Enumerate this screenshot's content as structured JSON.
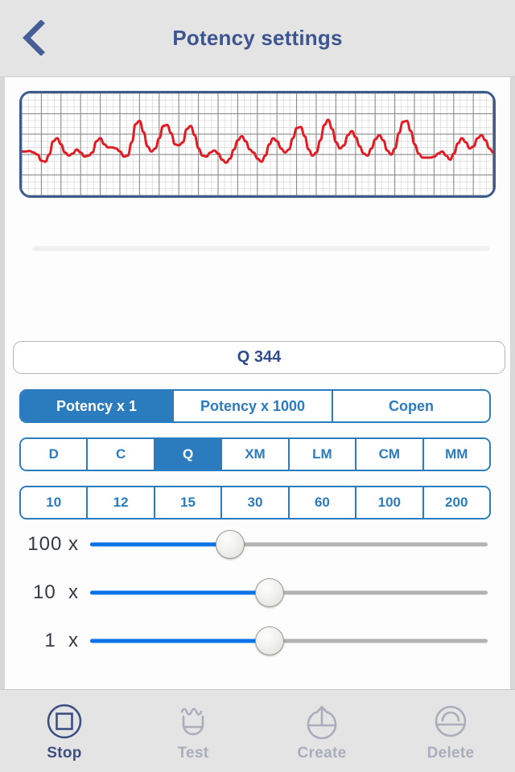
{
  "header": {
    "title": "Potency settings",
    "back_icon": "chevron-left-icon",
    "accent": "#3d5691"
  },
  "chart_data": {
    "type": "line",
    "title": "",
    "xlabel": "",
    "ylabel": "",
    "grid": true,
    "legend": null,
    "line_color": "#e31b23",
    "border_color": "#3d5b8c",
    "grid_color": "#8a8a8a",
    "minor_grid_color": "#d0d0d0",
    "ylim": [
      0,
      10
    ],
    "xlim": [
      0,
      120
    ],
    "x": [
      0,
      1,
      2,
      3,
      4,
      5,
      6,
      7,
      8,
      9,
      10,
      11,
      12,
      13,
      14,
      15,
      16,
      17,
      18,
      19,
      20,
      21,
      22,
      23,
      24,
      25,
      26,
      27,
      28,
      29,
      30,
      31,
      32,
      33,
      34,
      35,
      36,
      37,
      38,
      39,
      40,
      41,
      42,
      43,
      44,
      45,
      46,
      47,
      48,
      49,
      50,
      51,
      52,
      53,
      54,
      55,
      56,
      57,
      58,
      59,
      60,
      61,
      62,
      63,
      64,
      65,
      66,
      67,
      68,
      69,
      70,
      71,
      72,
      73,
      74,
      75,
      76,
      77,
      78,
      79,
      80,
      81,
      82,
      83,
      84,
      85,
      86,
      87,
      88,
      89,
      90,
      91,
      92,
      93,
      94,
      95,
      96,
      97,
      98,
      99,
      100,
      101,
      102,
      103,
      104,
      105,
      106,
      107,
      108,
      109,
      110,
      111,
      112,
      113,
      114,
      115,
      116,
      117,
      118,
      119,
      120
    ],
    "values": [
      4.3,
      4.3,
      4.35,
      4.2,
      4.0,
      3.4,
      3.3,
      4.0,
      5.3,
      5.6,
      5.0,
      4.2,
      3.9,
      4.1,
      4.5,
      4.2,
      3.8,
      3.9,
      4.2,
      5.3,
      5.6,
      5.0,
      4.7,
      4.7,
      4.6,
      4.3,
      3.8,
      3.9,
      5.2,
      7.0,
      7.3,
      6.2,
      4.8,
      4.3,
      4.6,
      5.6,
      6.8,
      6.9,
      6.1,
      5.0,
      4.9,
      5.2,
      6.5,
      6.8,
      5.9,
      4.6,
      3.9,
      3.8,
      4.2,
      4.4,
      4.1,
      3.5,
      3.2,
      3.6,
      4.5,
      5.4,
      5.8,
      5.3,
      4.5,
      4.2,
      3.6,
      3.3,
      3.9,
      5.0,
      5.6,
      5.3,
      4.6,
      4.2,
      4.5,
      5.6,
      6.6,
      6.7,
      5.8,
      4.5,
      3.9,
      4.2,
      5.4,
      6.9,
      7.4,
      6.5,
      5.2,
      4.6,
      4.9,
      5.9,
      6.3,
      5.7,
      4.8,
      4.1,
      3.9,
      4.6,
      5.5,
      5.9,
      5.4,
      4.4,
      4.0,
      4.6,
      6.1,
      7.2,
      7.3,
      6.3,
      5.0,
      4.1,
      3.7,
      3.7,
      3.7,
      3.8,
      4.1,
      4.3,
      3.9,
      3.5,
      4.1,
      5.1,
      5.6,
      5.2,
      4.6,
      4.8,
      5.6,
      5.9,
      5.4,
      4.6,
      4.2
    ]
  },
  "progress": {
    "name": "progress-track",
    "value": 0
  },
  "value_field": {
    "value": "Q 344",
    "placeholder": "Q 344"
  },
  "potency_modes": {
    "options": [
      {
        "label": "Potency x 1",
        "selected": true
      },
      {
        "label": "Potency x 1000",
        "selected": false
      },
      {
        "label": "Copen",
        "selected": false
      }
    ]
  },
  "potency_scales": {
    "options": [
      {
        "label": "D",
        "selected": false
      },
      {
        "label": "C",
        "selected": false
      },
      {
        "label": "Q",
        "selected": true
      },
      {
        "label": "XM",
        "selected": false
      },
      {
        "label": "LM",
        "selected": false
      },
      {
        "label": "CM",
        "selected": false
      },
      {
        "label": "MM",
        "selected": false
      }
    ]
  },
  "potency_values": {
    "options": [
      {
        "label": "10",
        "selected": false
      },
      {
        "label": "12",
        "selected": false
      },
      {
        "label": "15",
        "selected": false
      },
      {
        "label": "30",
        "selected": false
      },
      {
        "label": "60",
        "selected": false
      },
      {
        "label": "100",
        "selected": false
      },
      {
        "label": "200",
        "selected": false
      }
    ]
  },
  "sliders": [
    {
      "label": "100 x",
      "percent": 35
    },
    {
      "label": "10  x",
      "percent": 45
    },
    {
      "label": "1  x",
      "percent": 45
    }
  ],
  "tabbar": {
    "items": [
      {
        "label": "Stop",
        "icon": "stop-square-icon",
        "active": true
      },
      {
        "label": "Test",
        "icon": "test-wave-cup-icon",
        "active": false
      },
      {
        "label": "Create",
        "icon": "create-upload-icon",
        "active": false
      },
      {
        "label": "Delete",
        "icon": "delete-cup-icon",
        "active": false
      }
    ],
    "active_color": "#3d4f82",
    "inactive_color": "#a9adbc"
  }
}
